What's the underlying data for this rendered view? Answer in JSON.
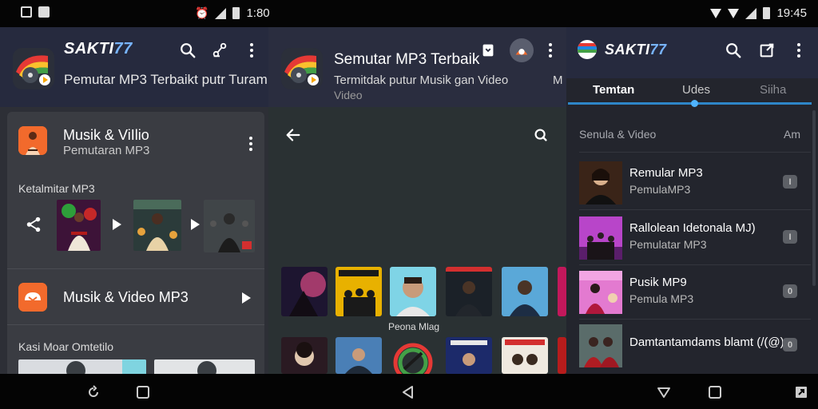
{
  "status_bar": {
    "mid_time": "1:80",
    "right_time": "19:45"
  },
  "panel1": {
    "app_title_a": "SAKTI",
    "app_title_b": "77",
    "app_subtitle": "Pemutar MP3 Terbaikt putr Turam",
    "card_title": "Musik & ViIlio",
    "card_subtitle": "Pemutaran MP3",
    "section1_label": "Ketalmitar MP3",
    "row2_title": "Musik & Video MP3",
    "section2_label": "Kasi Moar Omtetilo"
  },
  "panel2": {
    "header_title": "Semutar MP3 Terbaik",
    "header_sub_line1": "Termitdak putur Musik gan Video",
    "header_sub_line2": "Video",
    "header_sub_edge": "M",
    "tile_caption": "Peona Mlag"
  },
  "panel3": {
    "app_title_a": "SAKTI",
    "app_title_b": "77",
    "tabs": [
      {
        "label": "Temtan"
      },
      {
        "label": "Udes"
      },
      {
        "label": "Siiha"
      }
    ],
    "section_label": "Senula & Video",
    "section_right": "Am",
    "items": [
      {
        "title": "Remular MP3",
        "subtitle": "PemulaMP3",
        "badge": "I"
      },
      {
        "title": "Rallolean Idetonala MJ)",
        "subtitle": "Pemulatar MP3",
        "badge": "I"
      },
      {
        "title": "Pusik MP9",
        "subtitle": "Pemula MP3",
        "badge": "0"
      },
      {
        "title": "Damtantamdams blamt (/(@)",
        "subtitle": "",
        "badge": "0"
      }
    ]
  },
  "colors": {
    "accent_blue": "#78b4ff",
    "tab_indicator": "#2e86c8",
    "orange": "#f26a2c",
    "appbar": "#262a3e"
  }
}
